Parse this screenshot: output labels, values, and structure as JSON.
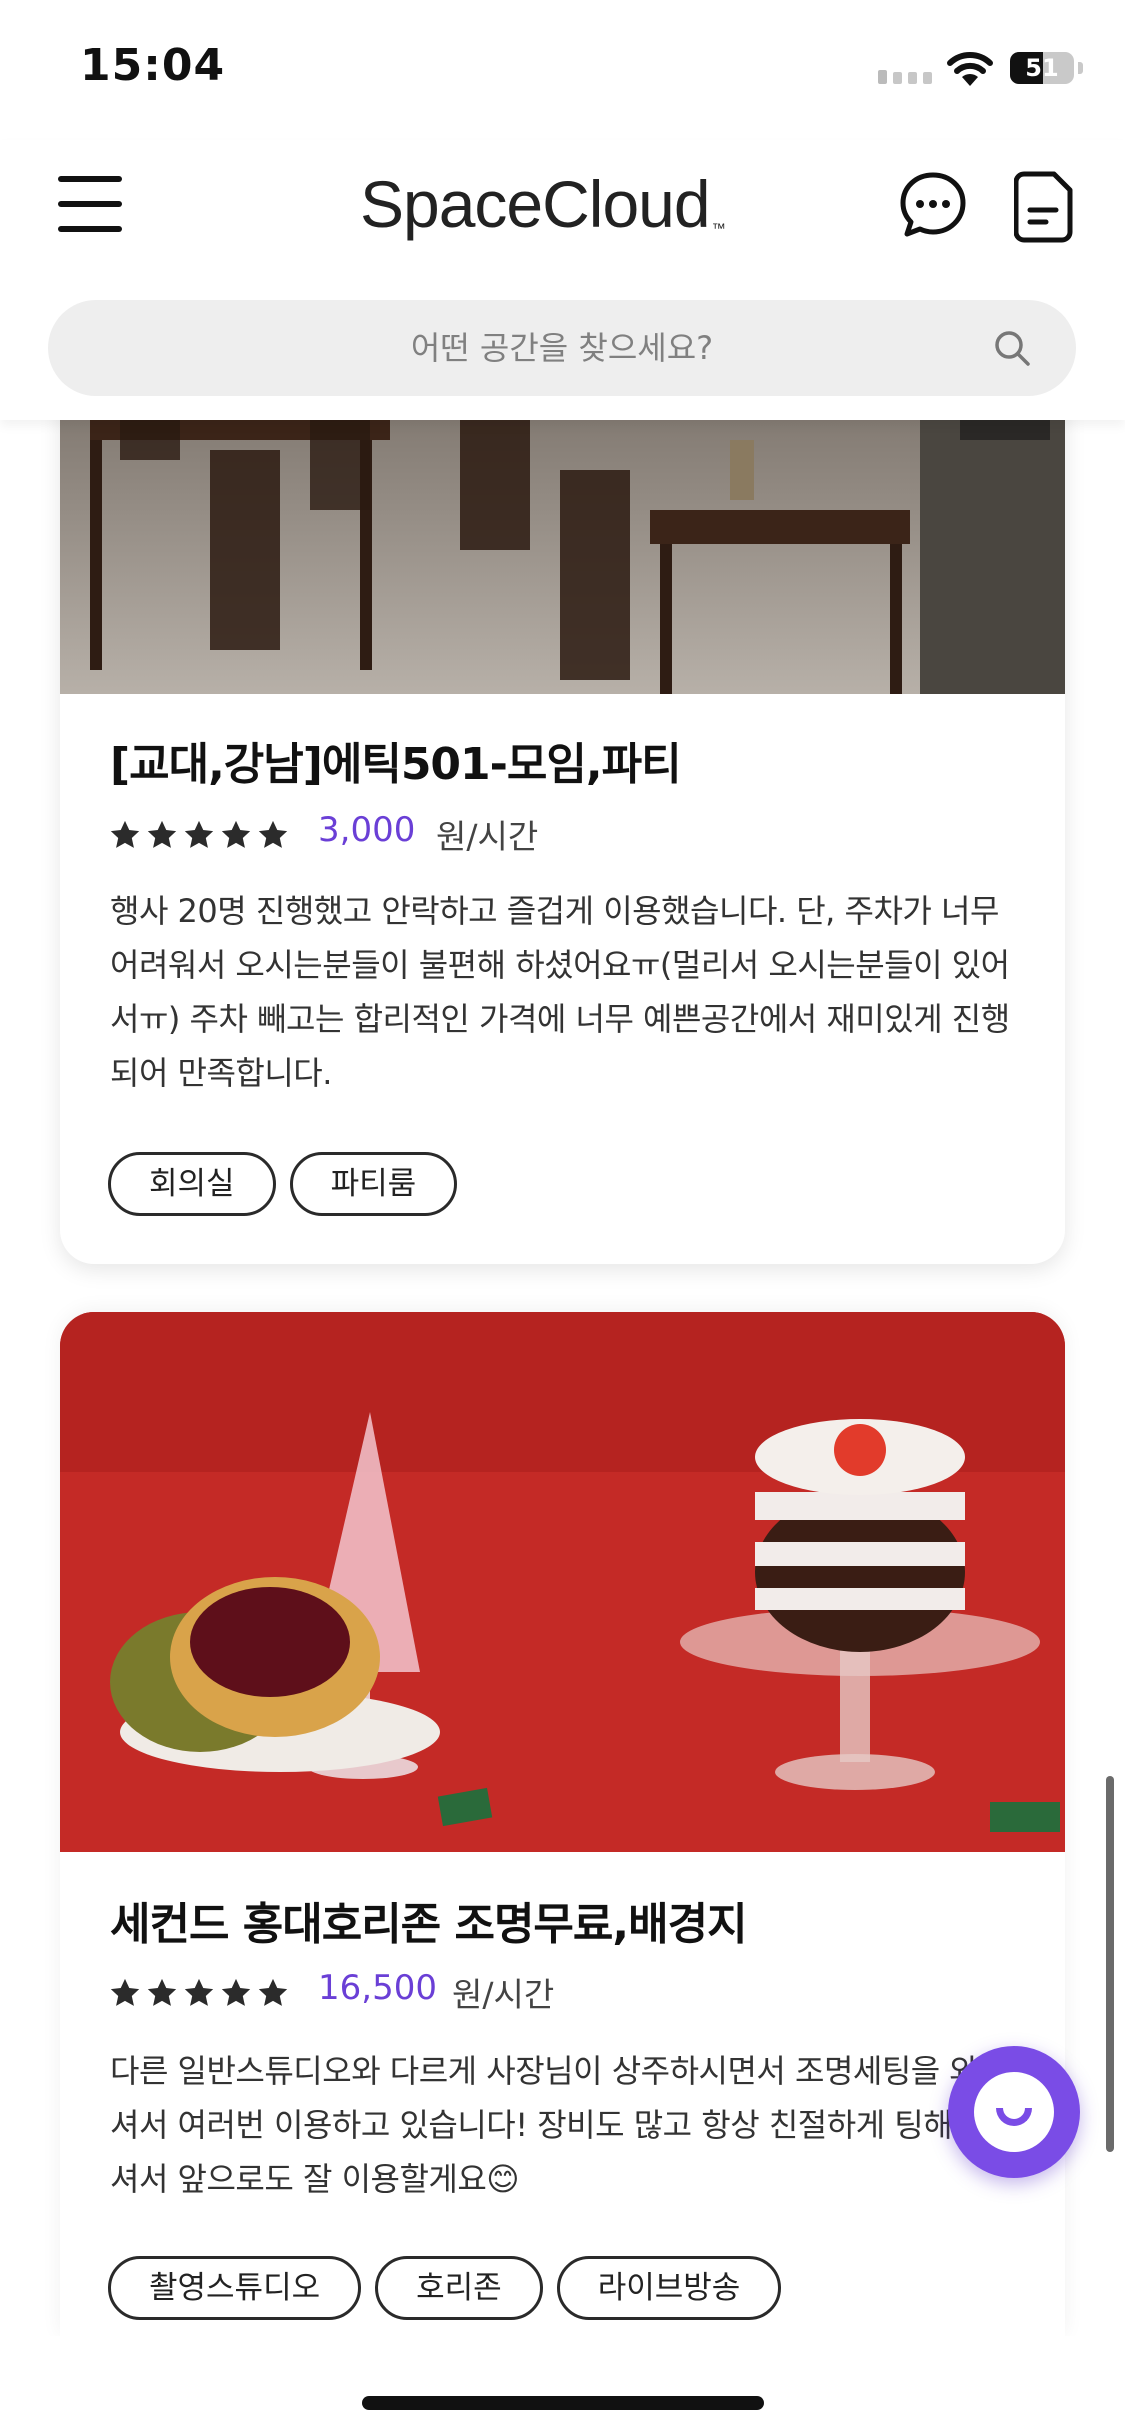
{
  "status_bar": {
    "time": "15:04",
    "battery": "51",
    "battery_level": 0.51
  },
  "header": {
    "logo": "SpaceCloud",
    "logo_mark": "™",
    "menu_icon": "hamburger-menu-icon",
    "chat_icon": "chat-bubble-icon",
    "doc_icon": "document-icon"
  },
  "search": {
    "placeholder": "어떤 공간을 찾으세요?",
    "icon": "search-icon"
  },
  "listings": [
    {
      "title": "[교대,강남]에틱501-모임,파티",
      "rating_stars": 5,
      "price": "3,000",
      "price_unit": "원/시간",
      "review": "행사 20명 진행했고 안락하고 즐겁게 이용했습니다. 단, 주차가 너무 어려워서 오시는분들이 불편해 하셨어요ㅠ(멀리서 오시는분들이 있어서ㅠ) 주차 빼고는 합리적인 가격에 너무 예쁜공간에서 재미있게 진행되어 만족합니다.",
      "tags": [
        "회의실",
        "파티룸"
      ]
    },
    {
      "title": "세컨드 홍대호리존 조명무료,배경지",
      "rating_stars": 5,
      "price": "16,500",
      "price_unit": "원/시간",
      "review": "다른 일반스튜디오와 다르게 사장님이 상주하시면서 조명세팅을 와주셔서 여러번 이용하고 있습니다! 장비도 많고 항상 친절하게 팅해주셔서 앞으로도 잘 이용할게요😊",
      "tags": [
        "촬영스튜디오",
        "호리존",
        "라이브방송"
      ]
    }
  ],
  "colors": {
    "accent": "#6a3fd6",
    "fab": "#7a4ce6",
    "search_bg": "#eeeeee"
  }
}
